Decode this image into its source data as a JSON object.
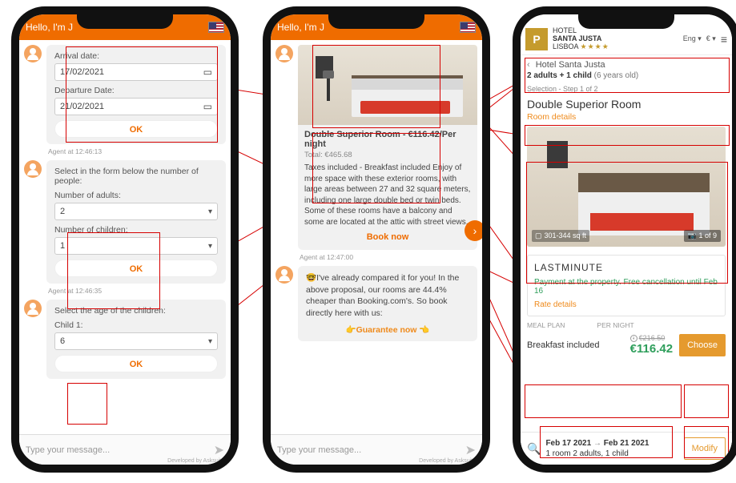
{
  "chat_header": {
    "greeting": "Hello, I'm J",
    "flag": "us"
  },
  "phone1": {
    "card1": {
      "arrival_label": "Arrival date:",
      "arrival_value": "17/02/2021",
      "departure_label": "Departure Date:",
      "departure_value": "21/02/2021",
      "ok": "OK",
      "timestamp": "Agent at 12:46:13"
    },
    "card2": {
      "prompt": "Select in the form below the number of people:",
      "adults_label": "Number of adults:",
      "adults_value": "2",
      "children_label": "Number of children:",
      "children_value": "1",
      "ok": "OK",
      "timestamp": "Agent at 12:46:35"
    },
    "card3": {
      "prompt": "Select the age of the children:",
      "child_label": "Child 1:",
      "child_value": "6",
      "ok": "OK"
    }
  },
  "phone2": {
    "room": {
      "title": "Double Superior Room - €116.42/Per night",
      "total": "Total: €465.68",
      "desc": "Taxes included - Breakfast included Enjoy of more space with these exterior rooms, with large areas between 27 and 32 square meters, including one large double bed or twin beds. Some of these rooms have a balcony and some are located at the attic with street views.",
      "book": "Book now",
      "timestamp": "Agent at 12:47:00"
    },
    "compare": {
      "text": "🤓I've already compared it for you! In the above proposal, our rooms are 44.4% cheaper than Booking.com's. So book directly here with us:",
      "guarantee": "👉Guarantee now 👈"
    }
  },
  "phone3": {
    "hotel": {
      "logo": "P",
      "line1": "HOTEL",
      "line2": "SANTA JUSTA",
      "line3": "LISBOA",
      "stars": "★★★★"
    },
    "header_right": {
      "lang": "Eng",
      "currency": "€"
    },
    "crumb": {
      "back": "‹",
      "name": "Hotel Santa Justa",
      "guests_main": "2 adults + 1 child",
      "guests_light": "(6 years old)"
    },
    "selection_step": "Selection - Step 1 of 2",
    "room_name": "Double Superior Room",
    "room_details": "Room details",
    "area_tag": "301-344 sq ft",
    "photo_count": "1 of 9",
    "lm": {
      "title": "LASTMINUTE",
      "cancel": "Payment at the property. Free cancellation until Feb 16",
      "rate": "Rate details"
    },
    "cols": {
      "meal": "MEAL PLAN",
      "per_night": "PER NIGHT"
    },
    "meal": {
      "name": "Breakfast included",
      "old": "€216.50",
      "new": "€116.42",
      "choose": "Choose"
    },
    "footer": {
      "from": "Feb 17 2021",
      "to": "Feb 21 2021",
      "sum": "1 room 2 adults, 1 child",
      "modify": "Modify"
    }
  },
  "input_placeholder": "Type your message...",
  "developed_by": "Developed by Asksuite"
}
